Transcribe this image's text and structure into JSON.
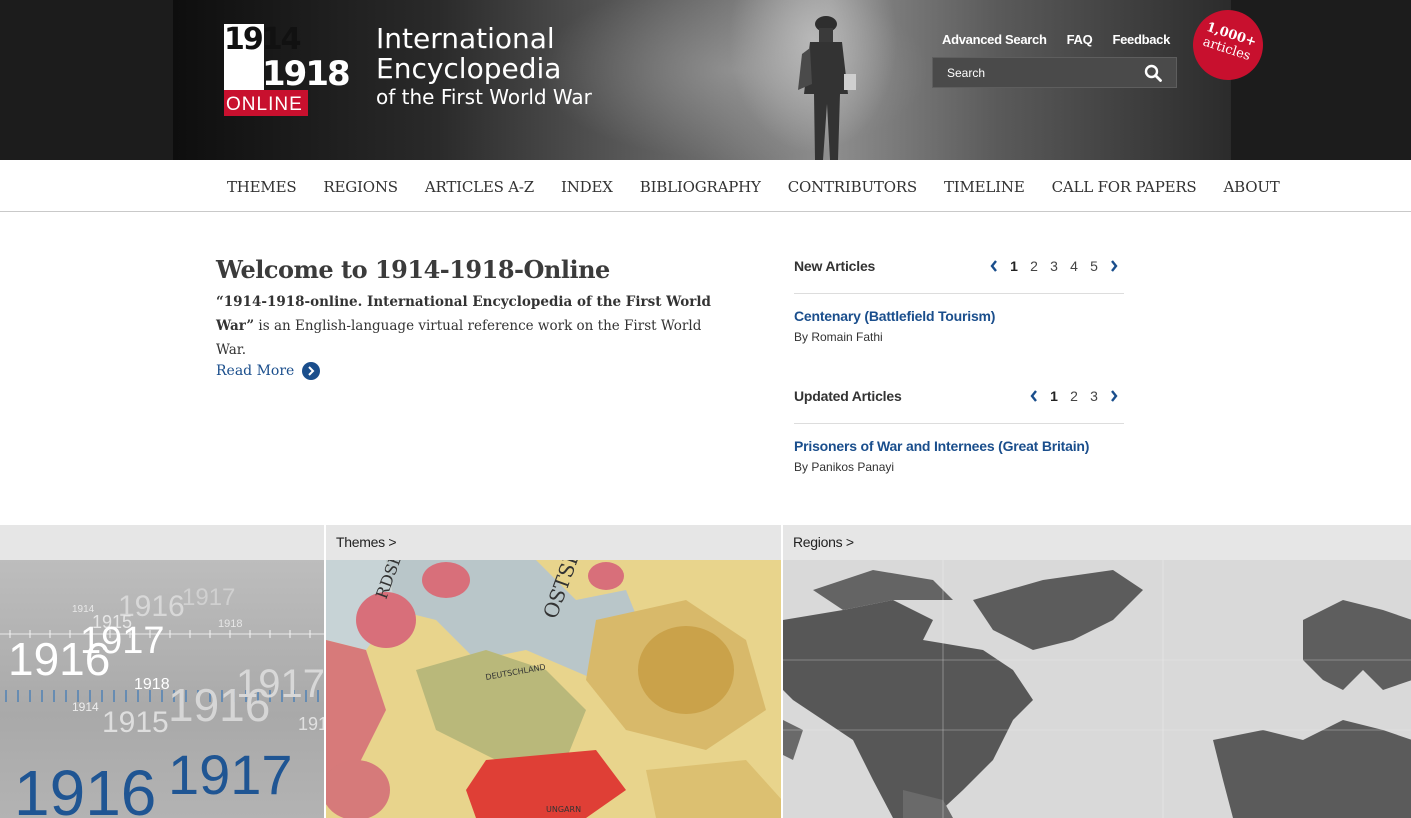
{
  "header": {
    "logo": {
      "top": "1914",
      "bottom": "1918",
      "tag": "ONLINE"
    },
    "title_line1": "International",
    "title_line2": "Encyclopedia",
    "title_line3": "of the First World War",
    "links": [
      "Advanced Search",
      "FAQ",
      "Feedback"
    ],
    "search": {
      "placeholder": "Search"
    },
    "badge": {
      "line1": "1,000+",
      "line2": "articles"
    }
  },
  "nav": {
    "items": [
      "THEMES",
      "REGIONS",
      "ARTICLES A-Z",
      "INDEX",
      "BIBLIOGRAPHY",
      "CONTRIBUTORS",
      "TIMELINE",
      "CALL FOR PAPERS",
      "ABOUT"
    ]
  },
  "welcome": {
    "heading": "Welcome to 1914-1918-Online",
    "intro_bold": "“1914-1918-online. International Encyclopedia of the First World War”",
    "intro_rest": " is an English-language virtual reference work on the First World War.",
    "read_more": "Read More"
  },
  "new_articles": {
    "heading": "New Articles",
    "pages": [
      "1",
      "2",
      "3",
      "4",
      "5"
    ],
    "current_page": "1",
    "article": {
      "title": "Centenary (Battlefield Tourism)",
      "author": "By Romain Fathi"
    }
  },
  "updated_articles": {
    "heading": "Updated Articles",
    "pages": [
      "1",
      "2",
      "3"
    ],
    "current_page": "1",
    "article": {
      "title": "Prisoners of War and Internees (Great Britain)",
      "author": "By Panikos Panayi"
    }
  },
  "panels": {
    "timeline_label": "",
    "themes_label": "Themes >",
    "regions_label": "Regions >",
    "timeline_years": [
      "1914",
      "1915",
      "1916",
      "1917",
      "1918"
    ]
  },
  "colors": {
    "accent_red": "#c8102e",
    "link_blue": "#1a4e8c",
    "header_dark": "#1c1c1c"
  }
}
